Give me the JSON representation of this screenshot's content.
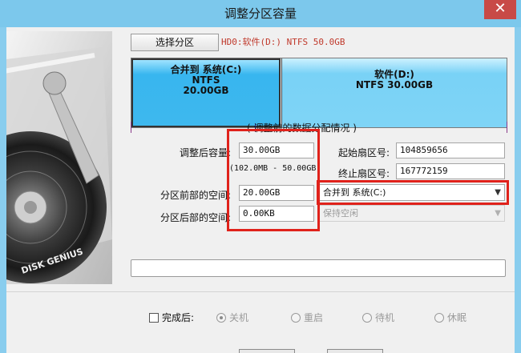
{
  "window": {
    "title": "调整分区容量",
    "close_glyph": "✕"
  },
  "side_image": {
    "brand_text": "DISK GENIUS"
  },
  "disk": {
    "select_button": "选择分区",
    "label": "HD0:软件(D:) NTFS 50.0GB"
  },
  "partitions": [
    {
      "line1": "合并到 系统(C:)",
      "line2": "NTFS",
      "line3": "20.00GB"
    },
    {
      "line1": "软件(D:)",
      "line2": "NTFS 30.00GB"
    }
  ],
  "caption": "( 调整前的数据分配情况 )",
  "form": {
    "new_size_label": "调整后容量:",
    "new_size_value": "30.00GB",
    "range_text": "(102.0MB - 50.00GB)",
    "before_label": "分区前部的空间:",
    "before_value": "20.00GB",
    "after_label": "分区后部的空间:",
    "after_value": "0.00KB",
    "start_sector_label": "起始扇区号:",
    "start_sector_value": "104859656",
    "end_sector_label": "终止扇区号:",
    "end_sector_value": "167772159",
    "before_action": "合并到 系统(C:)",
    "after_action": "保持空闲"
  },
  "after_done": {
    "checkbox_label": "完成后:",
    "options": [
      "关机",
      "重启",
      "待机",
      "休眠"
    ],
    "selected": "关机"
  },
  "colors": {
    "titlebar": "#7cc8ec",
    "close": "#c84a47",
    "partition_selected": "#3eb8ee",
    "partition_other": "#7fd4f6",
    "highlight": "#e0221b"
  }
}
